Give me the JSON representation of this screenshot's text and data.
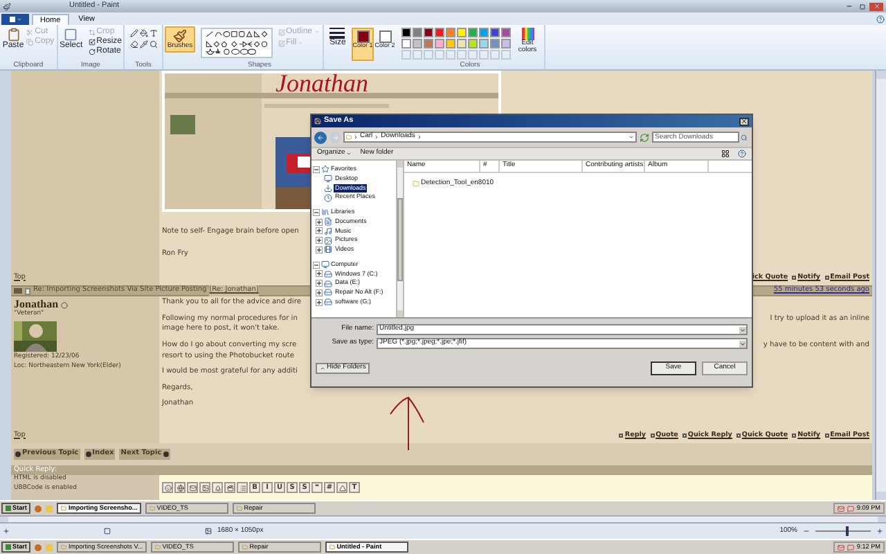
{
  "window": {
    "title": "Untitled - Paint"
  },
  "ribbon_tabs": [
    {
      "label": "Home",
      "selected": true
    },
    {
      "label": "View",
      "selected": false
    }
  ],
  "ribbon": {
    "paste": "Paste",
    "clipboard_actions": [
      {
        "label": "Cut",
        "disabled": true
      },
      {
        "label": "Copy",
        "disabled": true
      }
    ],
    "clipboard_label": "Clipboard",
    "select": "Select",
    "image_actions": [
      {
        "label": "Crop",
        "disabled": true
      },
      {
        "label": "Resize",
        "disabled": false
      },
      {
        "label": "Rotate",
        "disabled": false
      }
    ],
    "image_label": "Image",
    "tools_label": "Tools",
    "brushes": {
      "label": "Brushes",
      "selected": true
    },
    "shape_options": [
      {
        "label": "Outline",
        "disabled": true
      },
      {
        "label": "Fill",
        "disabled": true
      }
    ],
    "shapes_label": "Shapes",
    "size_label": "Size",
    "color_slots": [
      {
        "label": "Color 1",
        "color": "#880015",
        "selected": true
      },
      {
        "label": "Color 2",
        "color": "#ffffff",
        "selected": false
      }
    ],
    "palette": [
      {
        "color": "#000000"
      },
      {
        "color": "#7f7f7f"
      },
      {
        "color": "#880015"
      },
      {
        "color": "#ed1c24"
      },
      {
        "color": "#ff7f27"
      },
      {
        "color": "#fff200"
      },
      {
        "color": "#22b14c"
      },
      {
        "color": "#00a2e8"
      },
      {
        "color": "#3f48cc"
      },
      {
        "color": "#a349a4"
      },
      {
        "color": "#ffffff"
      },
      {
        "color": "#c3c3c3"
      },
      {
        "color": "#b97a57"
      },
      {
        "color": "#ffaec9"
      },
      {
        "color": "#ffc90e"
      },
      {
        "color": "#efe4b0"
      },
      {
        "color": "#b5e61d"
      },
      {
        "color": "#99d9ea"
      },
      {
        "color": "#7092be"
      },
      {
        "color": "#c8bfe7"
      }
    ],
    "edit_colors": "Edit colors",
    "colors_label": "Colors"
  },
  "forum": {
    "embedded_screenshot": {
      "handwriting": "Jonathan"
    },
    "first_post": {
      "note": "Note to self- Engage brain before open",
      "signature": "Ron Fry",
      "top": "Top",
      "links": [
        "ick Quote",
        "Notify",
        "Email Post"
      ]
    },
    "second_post": {
      "subject": "Re: Importing Screenshots Via Site Picture Posting",
      "reply_to": "[Re: Jonathan]",
      "time": "55 minutes 53 seconds ago",
      "author": "Jonathan",
      "rank": "\"Veteran\"",
      "registered": "Registered: 12/23/06",
      "location": "Loc: Northeastern New York(Elder)",
      "paragraphs": [
        [
          {
            "left": "Thank you to all for the advice and dire"
          }
        ],
        [
          {
            "left": "Following my normal procedures for in",
            "right": "I try to upload it as an inline"
          },
          {
            "left": "image here to post, it won't take."
          }
        ],
        [
          {
            "left": "How do I go about converting my scre",
            "right": "y have to be content with and"
          },
          {
            "left": "resort to using the Photobucket route"
          }
        ],
        [
          {
            "left": "I would be most grateful for any additi"
          }
        ],
        [
          {
            "left": "Regards,"
          }
        ],
        [
          {
            "left": "Jonathan"
          }
        ]
      ],
      "top": "Top",
      "links": [
        "Reply",
        "Quote",
        "Quick Reply",
        "Quick Quote",
        "Notify",
        "Email Post"
      ]
    },
    "topic_nav": [
      "Previous Topic",
      "Index",
      "Next Topic"
    ],
    "quick_reply": {
      "title": "Quick Reply:",
      "notes": [
        "HTML is disabled",
        "UBBCode is enabled"
      ],
      "toolbar": [
        {
          "kind": "icon"
        },
        {
          "kind": "icon"
        },
        {
          "kind": "icon"
        },
        {
          "kind": "icon"
        },
        {
          "kind": "icon"
        },
        {
          "kind": "icon"
        },
        {
          "kind": "icon"
        },
        {
          "kind": "text",
          "label": "B"
        },
        {
          "kind": "text",
          "label": "I"
        },
        {
          "kind": "text",
          "label": "U"
        },
        {
          "kind": "text",
          "label": "S"
        },
        {
          "kind": "text",
          "label": "S"
        },
        {
          "kind": "text",
          "label": "❝"
        },
        {
          "kind": "text",
          "label": "#"
        },
        {
          "kind": "icon"
        },
        {
          "kind": "text",
          "label": "T"
        }
      ]
    }
  },
  "inner_taskbar": {
    "start": "Start",
    "items": [
      {
        "label": "Importing Screensho...",
        "selected": true
      },
      {
        "label": "VIDEO_TS",
        "selected": false
      },
      {
        "label": "Repair",
        "selected": false
      }
    ],
    "clock": "9:09 PM"
  },
  "status_bar": {
    "dimensions": "1680 × 1050px",
    "zoom": "100%",
    "zoom_slider": {
      "level": 0.55
    }
  },
  "taskbar": {
    "start": "Start",
    "items": [
      {
        "label": "Importing Screenshots V...",
        "selected": false
      },
      {
        "label": "VIDEO_TS",
        "selected": false
      },
      {
        "label": "Repair",
        "selected": false
      },
      {
        "label": "Untitled - Paint",
        "selected": true
      }
    ],
    "clock": "9:12 PM"
  },
  "dialog": {
    "title": "Save As",
    "address": [
      "Carl",
      "Downloads"
    ],
    "search": {
      "placeholder": "Search Downloads"
    },
    "toolbar": [
      "Organize",
      "New folder"
    ],
    "nav": [
      {
        "label": "Favorites",
        "kind": "favorites",
        "expanded": true,
        "children": [
          {
            "label": "Desktop",
            "kind": "desktop",
            "selected": false
          },
          {
            "label": "Downloads",
            "kind": "downloads",
            "selected": true
          },
          {
            "label": "Recent Places",
            "kind": "recent",
            "selected": false
          }
        ]
      },
      {
        "label": "Libraries",
        "kind": "libraries",
        "expanded": true,
        "children": [
          {
            "label": "Documents",
            "kind": "documents",
            "selected": false,
            "expanded": false
          },
          {
            "label": "Music",
            "kind": "music",
            "selected": false,
            "expanded": false
          },
          {
            "label": "Pictures",
            "kind": "pictures",
            "selected": false,
            "expanded": false
          },
          {
            "label": "Videos",
            "kind": "videos",
            "selected": false,
            "expanded": false
          }
        ]
      },
      {
        "label": "Computer",
        "kind": "computer",
        "expanded": true,
        "children": [
          {
            "label": "Windows 7 (C:)",
            "kind": "drive",
            "selected": false,
            "expanded": false
          },
          {
            "label": "Data (E:)",
            "kind": "drive",
            "selected": false,
            "expanded": false
          },
          {
            "label": "Repair No Alt (F:)",
            "kind": "drive",
            "selected": false,
            "expanded": false
          },
          {
            "label": "software (G:)",
            "kind": "drive",
            "selected": false,
            "expanded": false
          }
        ]
      }
    ],
    "columns": [
      "Name",
      "#",
      "Title",
      "Contributing artists",
      "Album"
    ],
    "files": [
      {
        "name": "Detection_Tool_en8010"
      }
    ],
    "file_name": {
      "label": "File name:",
      "value": "Untitled.jpg"
    },
    "save_type": {
      "label": "Save as type:",
      "value": "JPEG (*.jpg;*.jpeg;*.jpe;*.jfif)"
    },
    "hide_folders": "Hide Folders",
    "buttons": [
      "Save",
      "Cancel"
    ]
  }
}
